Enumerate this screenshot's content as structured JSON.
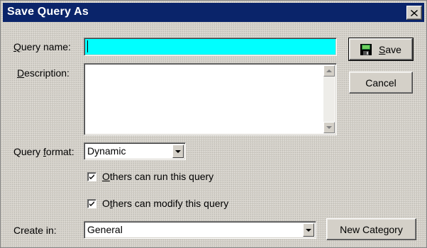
{
  "window": {
    "title": "Save Query As"
  },
  "form": {
    "query_name": {
      "accel": "Q",
      "rest": "uery name:",
      "value": ""
    },
    "description": {
      "accel": "D",
      "rest": "escription:",
      "value": ""
    },
    "query_format": {
      "before": "Query ",
      "accel": "f",
      "rest": "ormat:",
      "value": "Dynamic"
    },
    "others_run": {
      "accel": "O",
      "rest": "thers can run this query",
      "checked": true
    },
    "others_modify": {
      "before": "O",
      "accel": "t",
      "rest": "hers can modify this query",
      "checked": true
    },
    "create_in": {
      "label": "Create in:",
      "value": "General"
    }
  },
  "buttons": {
    "save": {
      "accel": "S",
      "rest": "ave"
    },
    "cancel": "Cancel",
    "new_category": "New Category"
  },
  "colors": {
    "title_bar": "#0a246a",
    "name_field_highlight": "#00ffff",
    "dialog_face": "#d4d0c8"
  },
  "icons": {
    "save": "floppy-disk-icon",
    "close": "close-icon"
  }
}
